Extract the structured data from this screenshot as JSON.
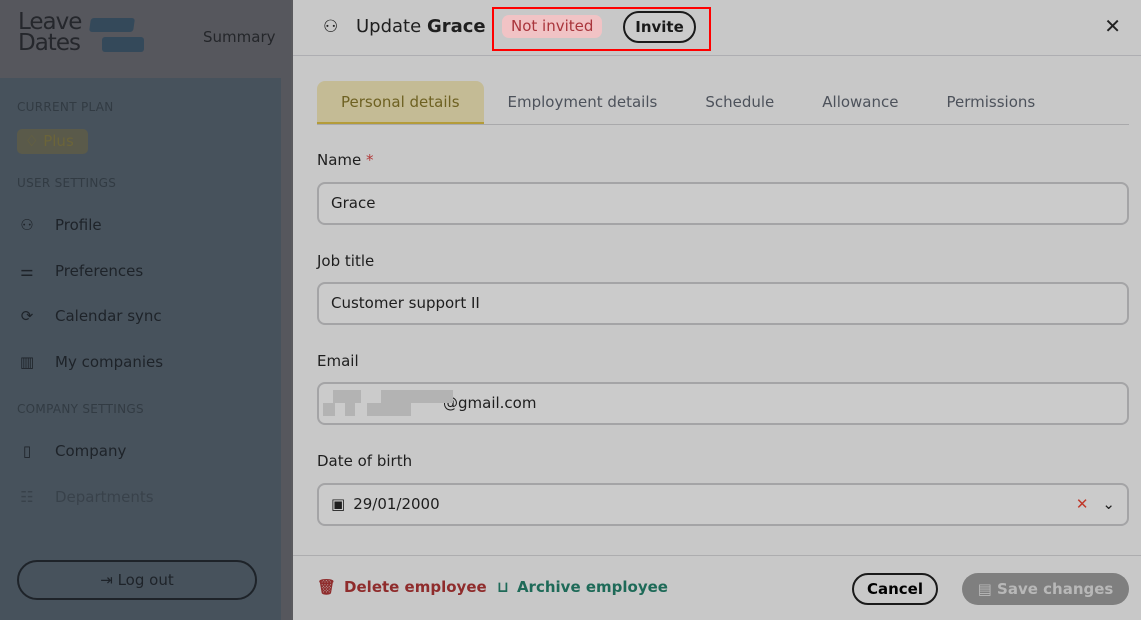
{
  "app": {
    "logo": "Leave Dates",
    "nav_summary": "Summary"
  },
  "sidebar": {
    "current_plan_label": "CURRENT PLAN",
    "plan": "Plus",
    "user_settings_label": "USER SETTINGS",
    "user_items": [
      {
        "label": "Profile",
        "icon": "user-icon"
      },
      {
        "label": "Preferences",
        "icon": "sliders-icon"
      },
      {
        "label": "Calendar sync",
        "icon": "sync-icon"
      },
      {
        "label": "My companies",
        "icon": "buildings-icon"
      }
    ],
    "company_settings_label": "COMPANY SETTINGS",
    "company_items": [
      {
        "label": "Company",
        "icon": "building-icon"
      },
      {
        "label": "Departments",
        "icon": "departments-icon"
      }
    ],
    "logout": "Log out"
  },
  "dialog": {
    "title_prefix": "Update",
    "title_name": "Grace",
    "status": "Not invited",
    "invite": "Invite",
    "tabs": [
      "Personal details",
      "Employment details",
      "Schedule",
      "Allowance",
      "Permissions"
    ],
    "fields": {
      "name_label": "Name",
      "name_required": "*",
      "name_value": "Grace",
      "job_label": "Job title",
      "job_value": "Customer support II",
      "email_label": "Email",
      "email_value": "@gmail.com",
      "dob_label": "Date of birth",
      "dob_value": "29/01/2000"
    },
    "footer": {
      "delete": "Delete employee",
      "archive": "Archive employee",
      "cancel": "Cancel",
      "save": "Save changes"
    }
  }
}
